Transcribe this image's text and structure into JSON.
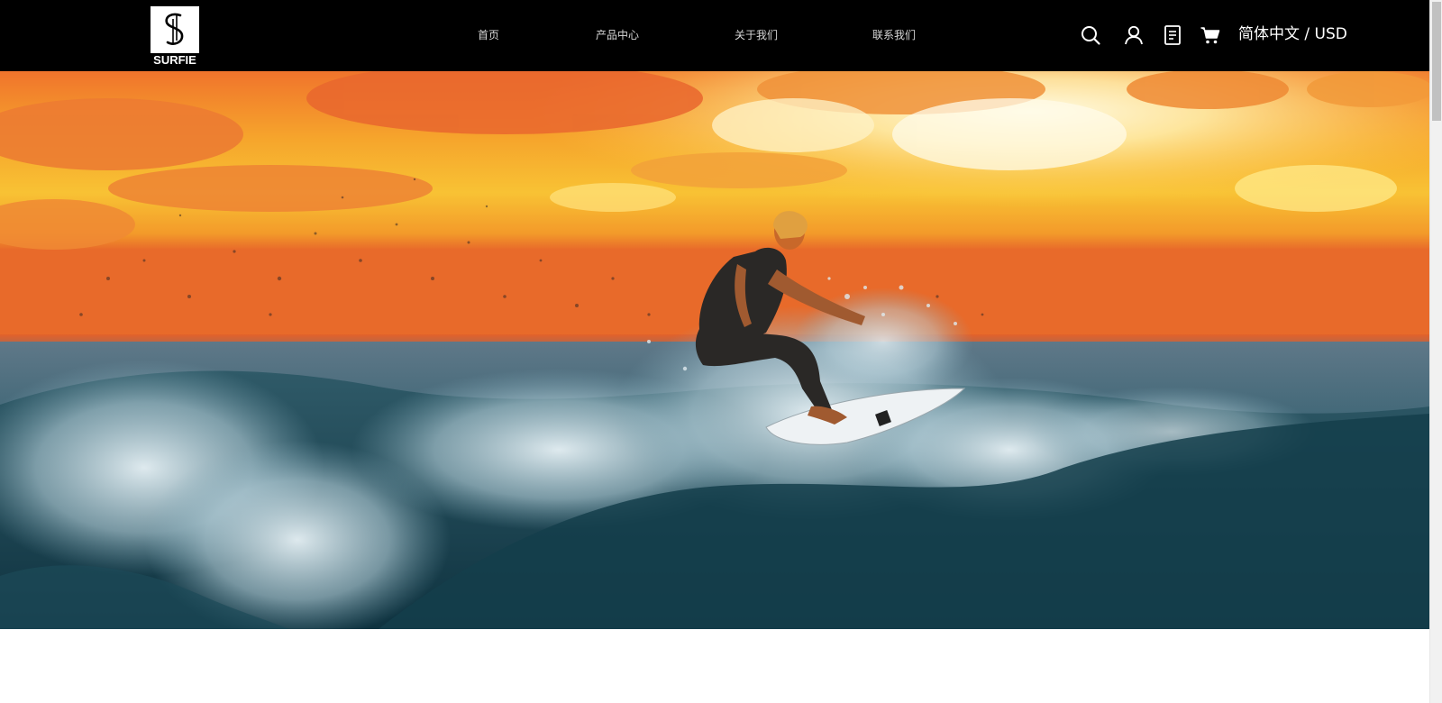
{
  "brand": {
    "logo_text": "SURFIE"
  },
  "nav": {
    "items": [
      {
        "label": "首页"
      },
      {
        "label": "产品中心"
      },
      {
        "label": "关于我们"
      },
      {
        "label": "联系我们"
      }
    ]
  },
  "header_tools": {
    "icons": [
      "search-icon",
      "user-icon",
      "orders-icon",
      "cart-icon"
    ],
    "language_currency": "简体中文 / USD"
  },
  "hero": {
    "scene": "surfer-at-sunset"
  },
  "colors": {
    "header_bg": "#000000",
    "nav_text": "#d8d8d8",
    "header_text": "#ffffff",
    "page_bg": "#ffffff"
  }
}
